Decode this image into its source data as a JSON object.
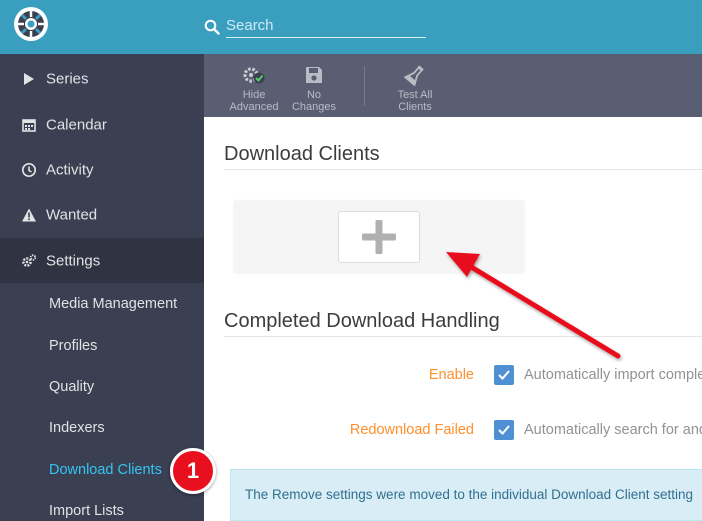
{
  "header": {
    "search_placeholder": "Search"
  },
  "sidebar": {
    "items": [
      {
        "label": "Series",
        "icon": "play-icon"
      },
      {
        "label": "Calendar",
        "icon": "calendar-icon"
      },
      {
        "label": "Activity",
        "icon": "clock-icon"
      },
      {
        "label": "Wanted",
        "icon": "warning-icon"
      },
      {
        "label": "Settings",
        "icon": "gears-icon"
      }
    ],
    "settings_sub": [
      {
        "label": "Media Management"
      },
      {
        "label": "Profiles"
      },
      {
        "label": "Quality"
      },
      {
        "label": "Indexers"
      },
      {
        "label": "Download Clients"
      },
      {
        "label": "Import Lists"
      }
    ]
  },
  "toolbar": {
    "hide_advanced_line1": "Hide",
    "hide_advanced_line2": "Advanced",
    "no_changes_line1": "No",
    "no_changes_line2": "Changes",
    "test_all_line1": "Test All",
    "test_all_line2": "Clients"
  },
  "main": {
    "download_clients_title": "Download Clients",
    "completed_title": "Completed Download Handling",
    "enable_label": "Enable",
    "enable_help": "Automatically import comple",
    "redownload_label": "Redownload Failed",
    "redownload_help": "Automatically search for and",
    "alert_text": "The Remove settings were moved to the individual Download Client setting"
  },
  "annotation": {
    "badge_number": "1"
  },
  "colors": {
    "header": "#3a9fbf",
    "sidebar": "#3a3f51",
    "toolbar": "#595e72",
    "accent": "#35c5f4",
    "label_orange": "#ff902b",
    "checkbox": "#4f8fd3",
    "arrow": "#e8101e"
  }
}
